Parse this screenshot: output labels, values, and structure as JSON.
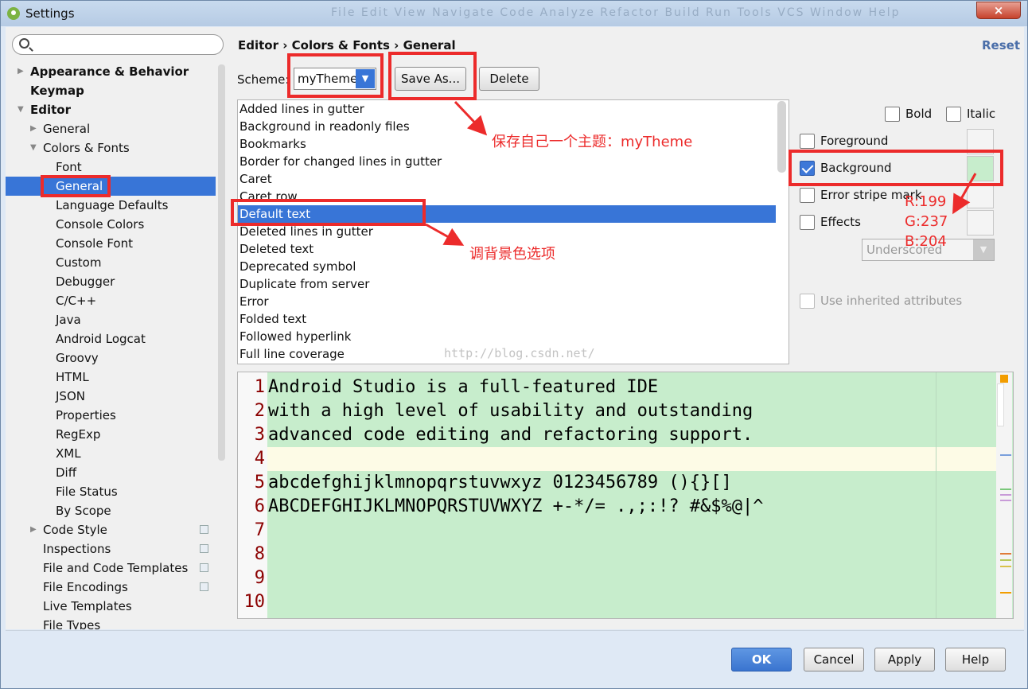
{
  "window": {
    "title": "Settings",
    "title_bar_ghost": "File Edit View Navigate Code Analyze Refactor Build Run Tools VCS Window Help",
    "close_glyph": "×"
  },
  "search": {
    "placeholder": ""
  },
  "tree": [
    {
      "label": "Appearance & Behavior",
      "bold": true,
      "arrow": "▶"
    },
    {
      "label": "Keymap",
      "bold": true
    },
    {
      "label": "Editor",
      "bold": true,
      "arrow": "▼"
    },
    {
      "label": "General",
      "arrow": "▶"
    },
    {
      "label": "Colors & Fonts",
      "arrow": "▼"
    },
    {
      "label": "Font"
    },
    {
      "label": "General",
      "selected": true
    },
    {
      "label": "Language Defaults"
    },
    {
      "label": "Console Colors"
    },
    {
      "label": "Console Font"
    },
    {
      "label": "Custom"
    },
    {
      "label": "Debugger"
    },
    {
      "label": "C/C++"
    },
    {
      "label": "Java"
    },
    {
      "label": "Android Logcat"
    },
    {
      "label": "Groovy"
    },
    {
      "label": "HTML"
    },
    {
      "label": "JSON"
    },
    {
      "label": "Properties"
    },
    {
      "label": "RegExp"
    },
    {
      "label": "XML"
    },
    {
      "label": "Diff"
    },
    {
      "label": "File Status"
    },
    {
      "label": "By Scope"
    },
    {
      "label": "Code Style",
      "arrow": "▶",
      "copy_icon": true
    },
    {
      "label": "Inspections",
      "copy_icon": true
    },
    {
      "label": "File and Code Templates",
      "copy_icon": true
    },
    {
      "label": "File Encodings",
      "copy_icon": true
    },
    {
      "label": "Live Templates"
    },
    {
      "label": "File Types"
    }
  ],
  "breadcrumb": "Editor › Colors & Fonts › General",
  "reset_label": "Reset",
  "scheme": {
    "label": "Scheme:",
    "value": "myTheme",
    "drop_glyph": "▼"
  },
  "buttons": {
    "save_as": "Save As...",
    "delete": "Delete",
    "ok": "OK",
    "cancel": "Cancel",
    "apply": "Apply",
    "help": "Help"
  },
  "attributes": [
    "Added lines in gutter",
    "Background in readonly files",
    "Bookmarks",
    "Border for changed lines in gutter",
    "Caret",
    "Caret row",
    "Default text",
    "Deleted lines in gutter",
    "Deleted text",
    "Deprecated symbol",
    "Duplicate from server",
    "Error",
    "Folded text",
    "Followed hyperlink",
    "Full line coverage"
  ],
  "selected_attribute": "Default text",
  "options": {
    "bold": "Bold",
    "italic": "Italic",
    "foreground": "Foreground",
    "background": "Background",
    "error_stripe": "Error stripe mark",
    "effects": "Effects",
    "effect_type": "Underscored",
    "use_inherited": "Use inherited attributes"
  },
  "background_color": "#c7edcc",
  "preview": {
    "line_numbers": [
      "1",
      "2",
      "3",
      "4",
      "5",
      "6",
      "7",
      "8",
      "9",
      "10"
    ],
    "lines": [
      "Android Studio is a full-featured IDE",
      "with a high level of usability and outstanding",
      "advanced code editing and refactoring support.",
      "",
      "abcdefghijklmnopqrstuvwxyz 0123456789 (){}[]",
      "ABCDEFGHIJKLMNOPQRSTUVWXYZ +-*/= .,;:!? #&$%@|^"
    ]
  },
  "watermark": "http://blog.csdn.net/",
  "annotations": {
    "save_theme": "保存自己一个主题：myTheme",
    "bg_option": "调背景色选项",
    "rgb_r": "R:199",
    "rgb_g": "G:237",
    "rgb_b": "B:204"
  },
  "colors": {
    "selection": "#3875d7",
    "annotation": "#ec2b2b",
    "link": "#4a6ea9"
  }
}
